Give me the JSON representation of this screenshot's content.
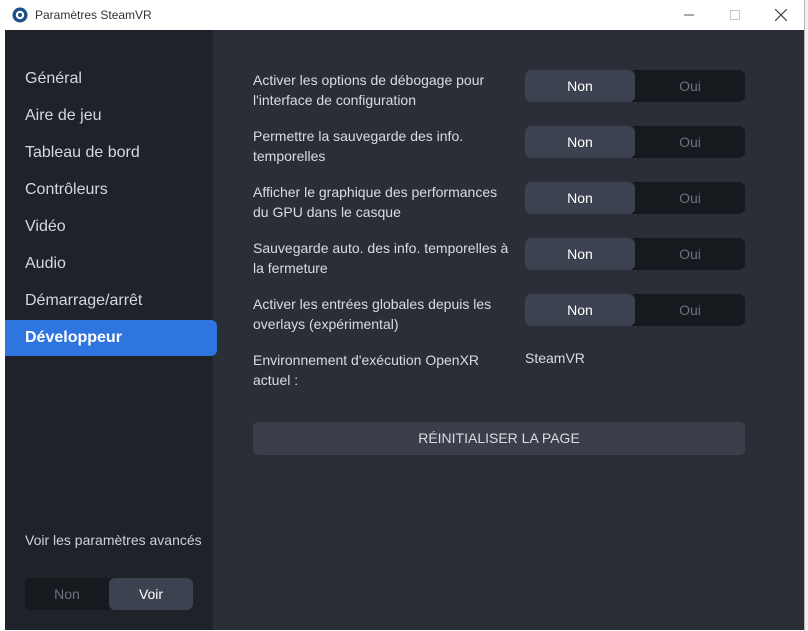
{
  "window": {
    "title": "Paramètres SteamVR",
    "icon": "steamvr-logo-icon",
    "controls": [
      "minimize-icon",
      "maximize-icon",
      "close-icon"
    ]
  },
  "sidebar": {
    "items": [
      {
        "label": "Général"
      },
      {
        "label": "Aire de jeu"
      },
      {
        "label": "Tableau de bord"
      },
      {
        "label": "Contrôleurs"
      },
      {
        "label": "Vidéo"
      },
      {
        "label": "Audio"
      },
      {
        "label": "Démarrage/arrêt"
      },
      {
        "label": "Développeur",
        "active": true
      }
    ],
    "advanced": {
      "label": "Voir les paramètres avancés",
      "options": [
        "Non",
        "Voir"
      ],
      "selected": "Voir"
    }
  },
  "settings": [
    {
      "label": "Activer les options de débogage pour l'interface de configuration",
      "options": [
        "Non",
        "Oui"
      ],
      "selected": "Non"
    },
    {
      "label": "Permettre la sauvegarde des info. temporelles",
      "options": [
        "Non",
        "Oui"
      ],
      "selected": "Non"
    },
    {
      "label": "Afficher le graphique des performances du GPU dans le casque",
      "options": [
        "Non",
        "Oui"
      ],
      "selected": "Non"
    },
    {
      "label": "Sauvegarde auto. des info. temporelles à la fermeture",
      "options": [
        "Non",
        "Oui"
      ],
      "selected": "Non"
    },
    {
      "label": "Activer les entrées globales depuis les overlays (expérimental)",
      "options": [
        "Non",
        "Oui"
      ],
      "selected": "Non"
    }
  ],
  "openxr_runtime": {
    "label": "Environnement d'exécution OpenXR actuel :",
    "value": "SteamVR"
  },
  "reset_button": {
    "label": "RÉINITIALISER LA PAGE"
  },
  "colors": {
    "background": "#2a2e36",
    "sidebar": "#1f2228",
    "accent": "#2f75e0",
    "toggle_track": "#161a1f",
    "toggle_selected": "#3c4250"
  }
}
